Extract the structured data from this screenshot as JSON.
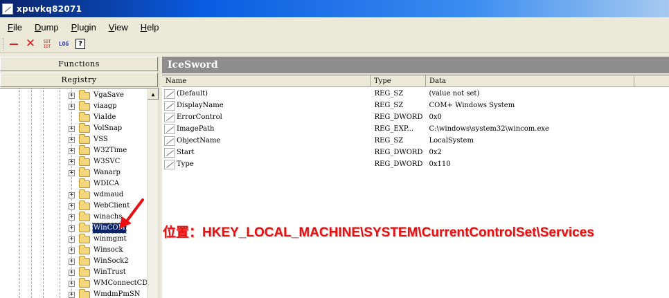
{
  "window": {
    "title": "xpuvkq82071"
  },
  "menu": [
    {
      "accel": "F",
      "rest": "ile"
    },
    {
      "accel": "D",
      "rest": "ump"
    },
    {
      "accel": "P",
      "rest": "lugin"
    },
    {
      "accel": "V",
      "rest": "iew"
    },
    {
      "accel": "H",
      "rest": "elp"
    }
  ],
  "toolbar": {
    "sdt_top": "SDT",
    "sdt_bottom": "IDT",
    "log": "LOG",
    "help": "?"
  },
  "left": {
    "functions_label": "Functions",
    "registry_label": "Registry",
    "tree": [
      {
        "label": "VgaSave",
        "expandable": true
      },
      {
        "label": "viaagp",
        "expandable": true
      },
      {
        "label": "ViaIde",
        "expandable": false
      },
      {
        "label": "VolSnap",
        "expandable": true
      },
      {
        "label": "VSS",
        "expandable": true
      },
      {
        "label": "W32Time",
        "expandable": true
      },
      {
        "label": "W3SVC",
        "expandable": true
      },
      {
        "label": "Wanarp",
        "expandable": true
      },
      {
        "label": "WDICA",
        "expandable": false
      },
      {
        "label": "wdmaud",
        "expandable": true
      },
      {
        "label": "WebClient",
        "expandable": true
      },
      {
        "label": "winachs",
        "expandable": true
      },
      {
        "label": "WinCOM",
        "expandable": true,
        "selected": true
      },
      {
        "label": "winmgmt",
        "expandable": true
      },
      {
        "label": "Winsock",
        "expandable": true
      },
      {
        "label": "WinSock2",
        "expandable": true
      },
      {
        "label": "WinTrust",
        "expandable": true
      },
      {
        "label": "WMConnectCDS",
        "expandable": true
      },
      {
        "label": "WmdmPmSN",
        "expandable": true
      }
    ]
  },
  "right": {
    "header": "IceSword",
    "columns": {
      "name": "Name",
      "type": "Type",
      "data": "Data"
    },
    "values": [
      {
        "name": "(Default)",
        "type": "REG_SZ",
        "data": "(value not set)"
      },
      {
        "name": "DisplayName",
        "type": "REG_SZ",
        "data": "COM+ Windows System"
      },
      {
        "name": "ErrorControl",
        "type": "REG_DWORD",
        "data": "0x0"
      },
      {
        "name": "ImagePath",
        "type": "REG_EXP...",
        "data": "C:\\windows\\system32\\wincom.exe"
      },
      {
        "name": "ObjectName",
        "type": "REG_SZ",
        "data": "LocalSystem"
      },
      {
        "name": "Start",
        "type": "REG_DWORD",
        "data": "0x2"
      },
      {
        "name": "Type",
        "type": "REG_DWORD",
        "data": "0x110"
      }
    ]
  },
  "annotation": {
    "text": "位置：HKEY_LOCAL_MACHINE\\SYSTEM\\CurrentControlSet\\Services",
    "color": "#e81010"
  }
}
